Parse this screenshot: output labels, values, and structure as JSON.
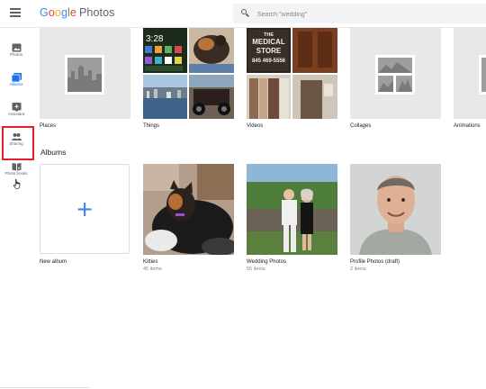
{
  "header": {
    "menu_icon": "hamburger-menu-icon",
    "logo_letters": [
      "G",
      "o",
      "o",
      "g",
      "l",
      "e"
    ],
    "product": "Photos",
    "search_placeholder": "Search \"wedding\""
  },
  "sidebar": {
    "items": [
      {
        "label": "Photos",
        "icon": "photo-icon"
      },
      {
        "label": "Albums",
        "icon": "albums-icon"
      },
      {
        "label": "Assistant",
        "icon": "assistant-icon"
      },
      {
        "label": "Sharing",
        "icon": "people-icon"
      },
      {
        "label": "Photo books",
        "icon": "photo-book-icon"
      }
    ],
    "highlighted": "Photo books"
  },
  "top_tiles": [
    {
      "label": "Places"
    },
    {
      "label": "Things"
    },
    {
      "label": "Videos"
    },
    {
      "label": "Collages"
    },
    {
      "label": "Animations"
    }
  ],
  "albums": {
    "title": "Albums",
    "items": [
      {
        "title": "New album",
        "count": ""
      },
      {
        "title": "Kitties",
        "count": "45 items"
      },
      {
        "title": "Wedding Photos",
        "count": "55 items"
      },
      {
        "title": "Profile Photos (draft)",
        "count": "2 items"
      }
    ]
  },
  "overlay_text": {
    "phone_time": "3:28",
    "store_sign_1": "THE",
    "store_sign_2": "MEDICAL",
    "store_sign_3": "STORE",
    "store_phone": "845 469-5556"
  }
}
